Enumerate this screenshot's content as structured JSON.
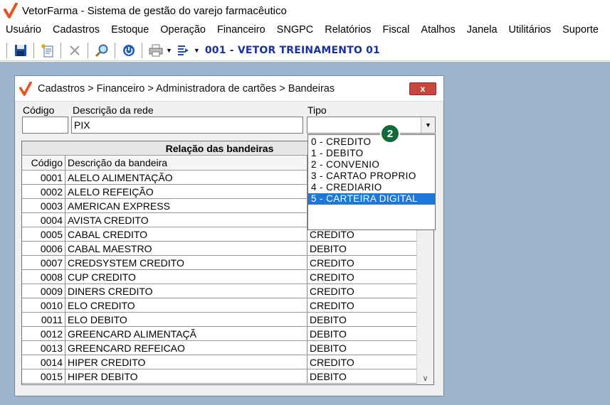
{
  "app": {
    "title": "VetorFarma - Sistema de gestão do varejo farmacêutico",
    "brand_color": "#e8531d"
  },
  "menu": [
    "Usuário",
    "Cadastros",
    "Estoque",
    "Operação",
    "Financeiro",
    "SNGPC",
    "Relatórios",
    "Fiscal",
    "Atalhos",
    "Janela",
    "Utilitários",
    "Suporte"
  ],
  "toolbar": {
    "icons": [
      "save-icon",
      "new-document-icon",
      "cancel-icon",
      "search-icon",
      "power-icon",
      "print-icon",
      "export-icon"
    ],
    "company": "001 - VETOR TREINAMENTO 01"
  },
  "window": {
    "title": "Cadastros > Financeiro > Administradora de cartões > Bandeiras",
    "close_label": "x"
  },
  "form": {
    "codigo_label": "Código",
    "codigo_value": "",
    "descricao_label": "Descrição da rede",
    "descricao_value": "PIX",
    "tipo_label": "Tipo",
    "tipo_value": "",
    "tipo_options": [
      "0 - CREDITO",
      "1 - DEBITO",
      "2 - CONVENIO",
      "3 - CARTAO PROPRIO",
      "4 - CREDIARIO",
      "5 - CARTEIRA DIGITAL"
    ],
    "tipo_highlighted": "5 - CARTEIRA DIGITAL"
  },
  "step_badge": "2",
  "grid": {
    "caption": "Relação das bandeiras",
    "headers": [
      "Código",
      "Descrição da bandeira",
      ""
    ],
    "rows": [
      [
        "0001",
        "ALELO ALIMENTAÇÃO",
        ""
      ],
      [
        "0002",
        "ALELO REFEIÇÃO",
        ""
      ],
      [
        "0003",
        "AMERICAN EXPRESS",
        ""
      ],
      [
        "0004",
        "AVISTA CREDITO",
        ""
      ],
      [
        "0005",
        "CABAL CREDITO",
        "CREDITO"
      ],
      [
        "0006",
        "CABAL MAESTRO",
        "DEBITO"
      ],
      [
        "0007",
        "CREDSYSTEM CREDITO",
        "CREDITO"
      ],
      [
        "0008",
        "CUP CREDITO",
        "CREDITO"
      ],
      [
        "0009",
        "DINERS CREDITO",
        "CREDITO"
      ],
      [
        "0010",
        "ELO CREDITO",
        "CREDITO"
      ],
      [
        "0011",
        "ELO DEBITO",
        "DEBITO"
      ],
      [
        "0012",
        "GREENCARD ALIMENTAÇÃ",
        "DEBITO"
      ],
      [
        "0013",
        "GREENCARD REFEICAO",
        "DEBITO"
      ],
      [
        "0014",
        "HIPER CREDITO",
        "CREDITO"
      ],
      [
        "0015",
        "HIPER DEBITO",
        "DEBITO"
      ]
    ]
  }
}
